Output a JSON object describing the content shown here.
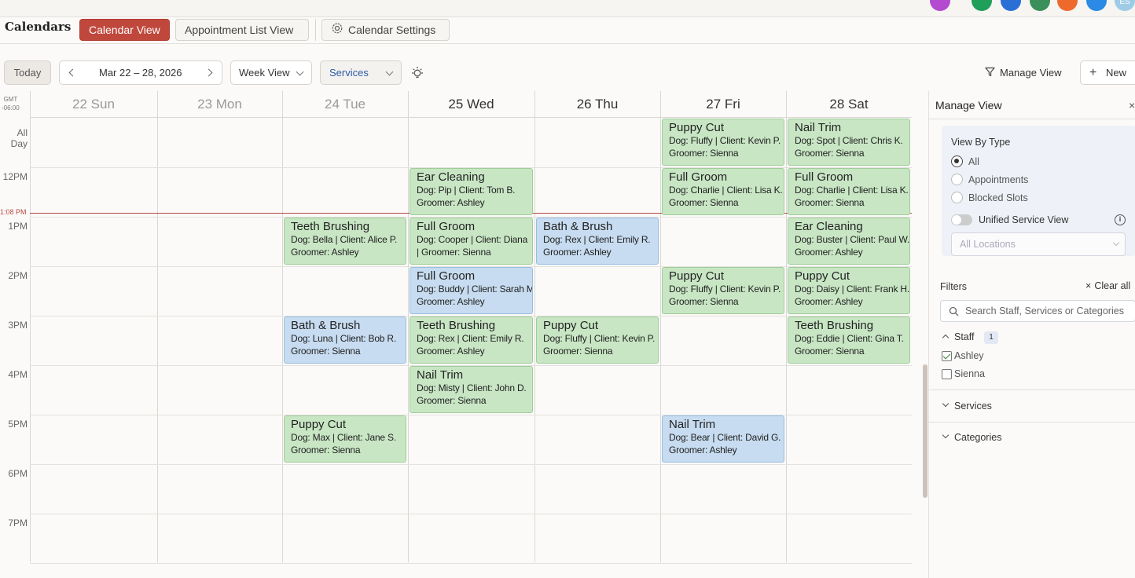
{
  "top_bar": {
    "avatar_initials": "ES",
    "icon_colors": [
      "#b44ad0",
      "#1f9f5a",
      "#2a6fd6",
      "#3a8f5a",
      "#ee6a2c",
      "#2a8ae6",
      "#9ecbe6"
    ]
  },
  "header": {
    "app_title": "Calendars",
    "tabs": [
      "Calendar View",
      "Appointment List View",
      "Calendar Settings"
    ],
    "active_tab": "Calendar View"
  },
  "toolbar": {
    "today_label": "Today",
    "date_range": "Mar 22 – 28, 2026",
    "view_select": "Week View",
    "filter_select": "Services",
    "manage_view_label": "Manage View",
    "new_label": "New"
  },
  "calendar": {
    "timezone_line1": "GMT",
    "timezone_line2": "-06:00",
    "days": [
      {
        "label": "22 Sun",
        "past": true
      },
      {
        "label": "23 Mon",
        "past": true
      },
      {
        "label": "24 Tue",
        "past": true
      },
      {
        "label": "25 Wed",
        "past": false
      },
      {
        "label": "26 Thu",
        "past": false
      },
      {
        "label": "27 Fri",
        "past": false
      },
      {
        "label": "28 Sat",
        "past": false
      }
    ],
    "time_labels": [
      "All Day",
      "12PM",
      "1PM",
      "2PM",
      "3PM",
      "4PM",
      "5PM",
      "6PM",
      "7PM"
    ],
    "current_time": "1:08 PM",
    "appointments": [
      {
        "day": 5,
        "slot": 0,
        "service": "Puppy Cut",
        "line1": "Dog: Fluffy | Client: Kevin P.",
        "line2": "Groomer: Sienna",
        "color": "green"
      },
      {
        "day": 6,
        "slot": 0,
        "service": "Nail Trim",
        "line1": "Dog: Spot | Client: Chris K.",
        "line2": "Groomer: Sienna",
        "color": "green"
      },
      {
        "day": 3,
        "slot": 1,
        "service": "Ear Cleaning",
        "line1": "Dog: Pip | Client: Tom B.",
        "line2": "Groomer: Ashley",
        "color": "green"
      },
      {
        "day": 5,
        "slot": 1,
        "service": "Full Groom",
        "line1": "Dog: Charlie | Client: Lisa K.",
        "line2": "Groomer: Sienna",
        "color": "green"
      },
      {
        "day": 6,
        "slot": 1,
        "service": "Full Groom",
        "line1": "Dog: Charlie | Client: Lisa K.",
        "line2": "Groomer: Sienna",
        "color": "green"
      },
      {
        "day": 2,
        "slot": 2,
        "service": "Teeth Brushing",
        "line1": "Dog: Bella | Client: Alice P.",
        "line2": "Groomer: Ashley",
        "color": "green"
      },
      {
        "day": 3,
        "slot": 2,
        "service": "Full Groom",
        "line1": "Dog: Cooper | Client: Diana",
        "line2": "| Groomer: Sienna",
        "color": "green"
      },
      {
        "day": 4,
        "slot": 2,
        "service": "Bath & Brush",
        "line1": "Dog: Rex | Client: Emily R.",
        "line2": "Groomer: Ashley",
        "color": "blue"
      },
      {
        "day": 6,
        "slot": 2,
        "service": "Ear Cleaning",
        "line1": "Dog: Buster | Client: Paul W.",
        "line2": "Groomer: Ashley",
        "color": "green"
      },
      {
        "day": 3,
        "slot": 3,
        "service": "Full Groom",
        "line1": "Dog: Buddy | Client: Sarah M.",
        "line2": "Groomer: Ashley",
        "color": "blue"
      },
      {
        "day": 5,
        "slot": 3,
        "service": "Puppy Cut",
        "line1": "Dog: Fluffy | Client: Kevin P.",
        "line2": "Groomer: Sienna",
        "color": "green"
      },
      {
        "day": 6,
        "slot": 3,
        "service": "Puppy Cut",
        "line1": "Dog: Daisy | Client: Frank H.",
        "line2": "Groomer: Ashley",
        "color": "green"
      },
      {
        "day": 2,
        "slot": 4,
        "service": "Bath & Brush",
        "line1": "Dog: Luna | Client: Bob R.",
        "line2": "Groomer: Sienna",
        "color": "blue"
      },
      {
        "day": 3,
        "slot": 4,
        "service": "Teeth Brushing",
        "line1": "Dog: Rex | Client: Emily R.",
        "line2": "Groomer: Ashley",
        "color": "green"
      },
      {
        "day": 4,
        "slot": 4,
        "service": "Puppy Cut",
        "line1": "Dog: Fluffy | Client: Kevin P.",
        "line2": "Groomer: Sienna",
        "color": "green"
      },
      {
        "day": 6,
        "slot": 4,
        "service": "Teeth Brushing",
        "line1": "Dog: Eddie | Client: Gina T.",
        "line2": "Groomer: Sienna",
        "color": "green"
      },
      {
        "day": 3,
        "slot": 5,
        "service": "Nail Trim",
        "line1": "Dog: Misty | Client: John D.",
        "line2": "Groomer: Sienna",
        "color": "green"
      },
      {
        "day": 2,
        "slot": 6,
        "service": "Puppy Cut",
        "line1": "Dog: Max | Client: Jane S.",
        "line2": "Groomer: Sienna",
        "color": "green"
      },
      {
        "day": 5,
        "slot": 6,
        "service": "Nail Trim",
        "line1": "Dog: Bear | Client: David G.",
        "line2": "Groomer: Ashley",
        "color": "blue"
      }
    ]
  },
  "manage_view": {
    "title": "Manage View",
    "close": "×",
    "view_by_type_label": "View By Type",
    "options": [
      "All",
      "Appointments",
      "Blocked Slots"
    ],
    "selected_option": "All",
    "unified_label": "Unified Service View",
    "unified_on": false,
    "locations_placeholder": "All Locations",
    "filters_label": "Filters",
    "clear_all": "Clear all",
    "search_placeholder": "Search Staff, Services or Categories",
    "staff_label": "Staff",
    "staff_count": "1",
    "staff": [
      {
        "name": "Ashley",
        "checked": true
      },
      {
        "name": "Sienna",
        "checked": false
      }
    ],
    "services_label": "Services",
    "categories_label": "Categories"
  }
}
